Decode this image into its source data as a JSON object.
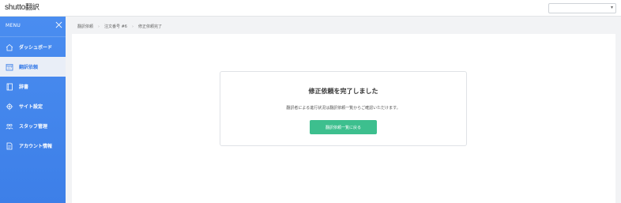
{
  "header": {
    "logo_brand": "shutto",
    "logo_suffix": "翻訳",
    "language_select_value": ""
  },
  "sidebar": {
    "menu_label": "MENU",
    "items": [
      {
        "label": "ダッシュボード",
        "icon": "house-icon"
      },
      {
        "label": "翻訳依頼",
        "icon": "calendar-icon",
        "active": true
      },
      {
        "label": "辞書",
        "icon": "book-icon"
      },
      {
        "label": "サイト設定",
        "icon": "gear-icon"
      },
      {
        "label": "スタッフ管理",
        "icon": "people-icon"
      },
      {
        "label": "アカウント情報",
        "icon": "document-icon"
      }
    ]
  },
  "breadcrumb": {
    "items": [
      "翻訳依頼",
      "注文番号 #6",
      "修正依頼完了"
    ]
  },
  "card": {
    "title": "修正依頼を完了しました",
    "description": "翻訳者による進行状況は翻訳依頼一覧からご確認いただけます。",
    "button_label": "翻訳依頼一覧に戻る"
  },
  "colors": {
    "sidebar": "#3d7fe8",
    "button": "#3dbf8e",
    "background": "#f2f3f5"
  }
}
